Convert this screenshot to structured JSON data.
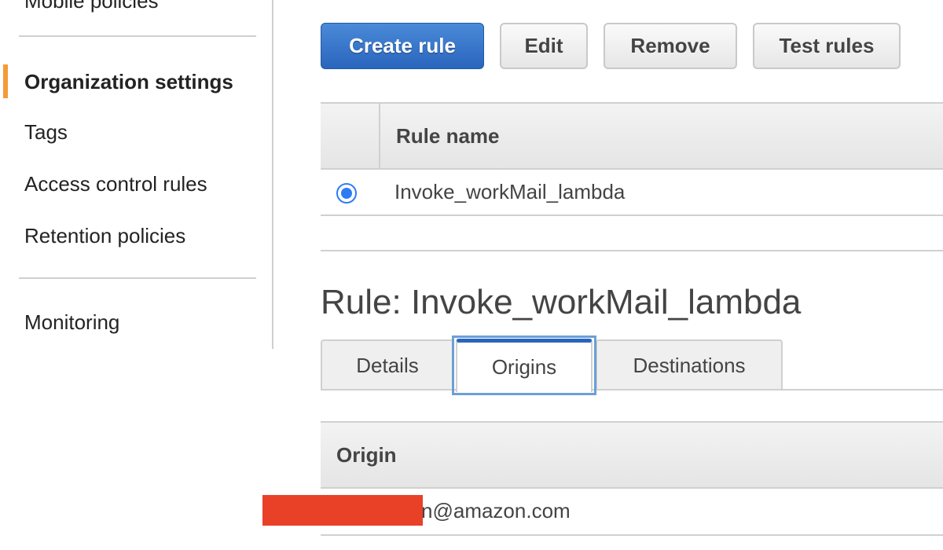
{
  "sidebar": {
    "partial_item": "Mobile policies",
    "items": [
      {
        "label": "Organization settings",
        "active": true
      },
      {
        "label": "Tags"
      },
      {
        "label": "Access control rules"
      },
      {
        "label": "Retention policies"
      },
      {
        "label": "Monitoring"
      }
    ],
    "accent_color": "#f49b37"
  },
  "toolbar": {
    "create_label": "Create rule",
    "edit_label": "Edit",
    "remove_label": "Remove",
    "test_label": "Test rules"
  },
  "rules_table": {
    "columns": [
      "",
      "Rule name"
    ],
    "rows": [
      {
        "selected": true,
        "name": "Invoke_workMail_lambda"
      }
    ]
  },
  "rule_detail": {
    "title": "Rule: Invoke_workMail_lambda",
    "tabs": [
      {
        "label": "Details",
        "active": false
      },
      {
        "label": "Origins",
        "active": true
      },
      {
        "label": "Destinations",
        "active": false
      }
    ],
    "origins_table": {
      "columns": [
        "Origin"
      ],
      "rows": [
        {
          "origin": "n@amazon.com",
          "redacted_prefix": true
        }
      ]
    }
  },
  "colors": {
    "primary": "#2a65bd",
    "radio": "#2d7cf6",
    "redaction": "#e84128"
  }
}
